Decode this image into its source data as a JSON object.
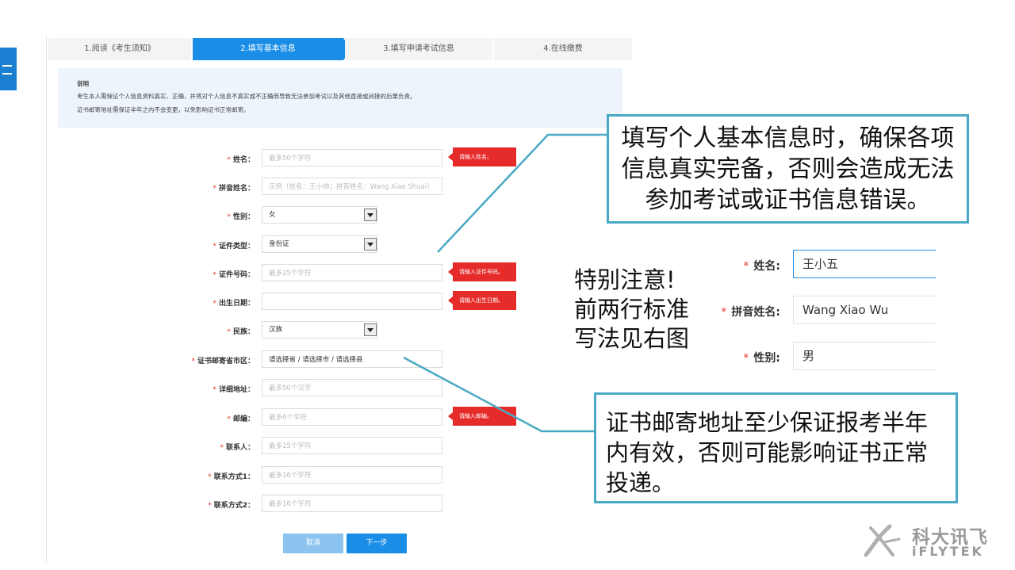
{
  "steps": [
    "1.阅读《考生须知》",
    "2.填写基本信息",
    "3.填写申请考试信息",
    "4.在线缴费"
  ],
  "notice": {
    "title": "说明",
    "line1": "考生本人需保证个人信息资料真实、正确，并将对个人信息不真实或不正确而导致无法参加考试以及其他直接或间接的后果负责。",
    "line2": "证书邮寄地址需保证半年之内不会变更，以免影响证书正常邮寄。"
  },
  "form": {
    "name": {
      "label": "姓名：",
      "placeholder": "最多50个字符",
      "error": "请输入姓名。"
    },
    "pinyin": {
      "label": "拼音姓名：",
      "placeholder": "示例（姓名：王小帅；拼音姓名：Wang Xiao Shuai）"
    },
    "gender": {
      "label": "性别：",
      "value": "女"
    },
    "id_type": {
      "label": "证件类型：",
      "value": "身份证"
    },
    "id_number": {
      "label": "证件号码：",
      "placeholder": "最多25个字符",
      "error": "请输入证件号码。"
    },
    "birth": {
      "label": "出生日期：",
      "placeholder": "",
      "error": "请输入出生日期。"
    },
    "ethnicity": {
      "label": "民族：",
      "value": "汉族"
    },
    "region": {
      "label": "证书邮寄省市区：",
      "value": "请选择省 / 请选择市 / 请选择县"
    },
    "address": {
      "label": "详细地址：",
      "placeholder": "最多50个汉字"
    },
    "postcode": {
      "label": "邮编：",
      "placeholder": "最多6个字符",
      "error": "请输入邮编。"
    },
    "contact": {
      "label": "联系人：",
      "placeholder": "最多15个字符"
    },
    "phone1": {
      "label": "联系方式1：",
      "placeholder": "最多16个字符"
    },
    "phone2": {
      "label": "联系方式2：",
      "placeholder": "最多16个字符"
    }
  },
  "buttons": {
    "cancel": "取消",
    "next": "下一步"
  },
  "callout1": "填写个人基本信息时，确保各项信息真实完备，否则会造成无法参加考试或证书信息错误。",
  "callout2": "证书邮寄地址至少保证报考半年内有效，否则可能影响证书正常投递。",
  "note": [
    "特别注意!",
    "前两行标准",
    "写法见右图"
  ],
  "example": {
    "name_label": "姓名:",
    "name_value": "王小五",
    "pinyin_label": "拼音姓名:",
    "pinyin_value": "Wang Xiao Wu",
    "gender_label": "性别:",
    "gender_value": "男"
  },
  "logo": {
    "cn": "科大讯飞",
    "en": "iFLYTEK"
  },
  "colors": {
    "accent": "#1a8ee6",
    "error": "#e62b2b",
    "callout_border": "#4aa9c4"
  }
}
